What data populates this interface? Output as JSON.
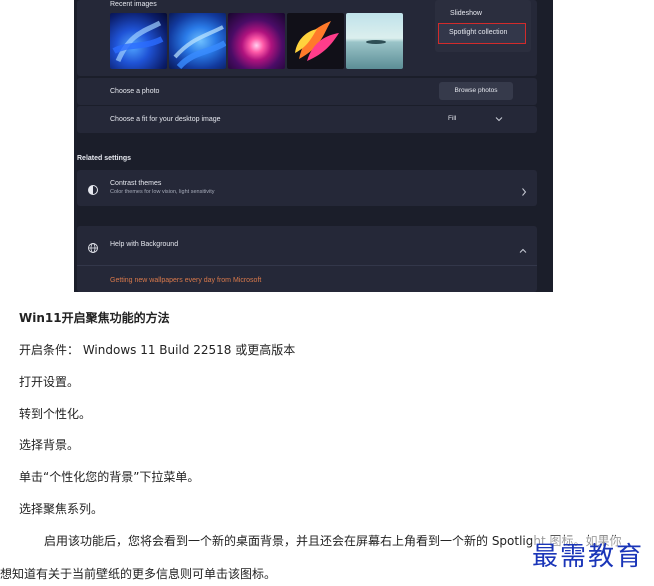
{
  "settings": {
    "recent_images_label": "Recent images",
    "dropdown_options": [
      "Slideshow",
      "Spotlight collection"
    ],
    "choose_photo_label": "Choose a photo",
    "browse_photos_button": "Browse photos",
    "choose_fit_label": "Choose a fit for your desktop image",
    "fit_value": "Fill",
    "related_settings_label": "Related settings",
    "contrast_title": "Contrast themes",
    "contrast_sub": "Color themes for low vision, light sensitivity",
    "help_title": "Help with Background",
    "help_link": "Getting new wallpapers every day from Microsoft",
    "colors": {
      "highlight_border": "#d22b2b",
      "link": "#d9794b",
      "panel": "#252838",
      "background": "#1b1e2a"
    }
  },
  "article": {
    "heading": "Win11开启聚焦功能的方法",
    "lines": [
      "开启条件： Windows 11 Build 22518 或更高版本",
      "打开设置。",
      "转到个性化。",
      "选择背景。",
      "单击“个性化您的背景”下拉菜单。",
      "选择聚焦系列。",
      "启用该功能后，您将会看到一个新的桌面背景，并且还会在屏幕右上角看到一个新的 Spotlight 图标。如果你",
      "想知道有关于当前壁纸的更多信息则可单击该图标。"
    ]
  },
  "watermark": "最需教育"
}
